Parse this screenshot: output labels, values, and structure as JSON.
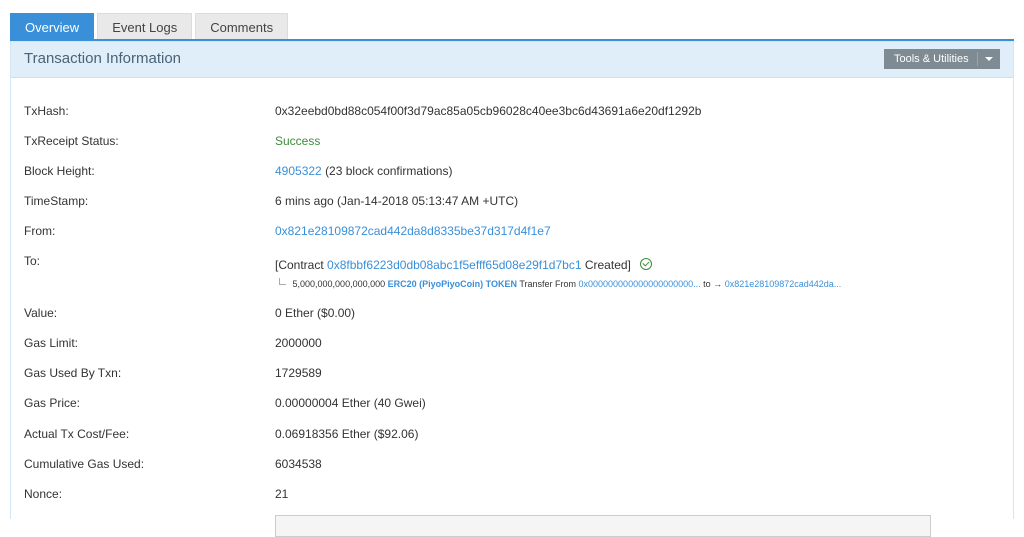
{
  "tabs": [
    "Overview",
    "Event Logs",
    "Comments"
  ],
  "panel": {
    "title": "Transaction Information",
    "tools_label": "Tools & Utilities"
  },
  "fields": {
    "txhash": {
      "label": "TxHash:",
      "value": "0x32eebd0bd88c054f00f3d79ac85a05cb96028c40ee3bc6d43691a6e20df1292b"
    },
    "status": {
      "label": "TxReceipt Status:",
      "value": "Success"
    },
    "block": {
      "label": "Block Height:",
      "link": "4905322",
      "suffix": "(23 block confirmations)"
    },
    "timestamp": {
      "label": "TimeStamp:",
      "value": "6 mins ago (Jan-14-2018 05:13:47 AM +UTC)"
    },
    "from": {
      "label": "From:",
      "value": "0x821e28109872cad442da8d8335be37d317d4f1e7"
    },
    "to": {
      "label": "To:",
      "prefix": "[Contract",
      "contract": "0x8fbbf6223d0db08abc1f5efff65d08e29f1d7bc1",
      "suffix": "Created]",
      "transfer": {
        "amount": "5,000,000,000,000,000",
        "token": "ERC20 (PiyoPiyoCoin) TOKEN",
        "text_from": "Transfer From",
        "from_addr": "0x000000000000000000000...",
        "text_to": "to →",
        "to_addr": "0x821e28109872cad442da..."
      }
    },
    "value": {
      "label": "Value:",
      "value": "0 Ether ($0.00)"
    },
    "gas_limit": {
      "label": "Gas Limit:",
      "value": "2000000"
    },
    "gas_used": {
      "label": "Gas Used By Txn:",
      "value": "1729589"
    },
    "gas_price": {
      "label": "Gas Price:",
      "value": "0.00000004 Ether (40 Gwei)"
    },
    "fee": {
      "label": "Actual Tx Cost/Fee:",
      "value": "0.06918356 Ether ($92.06)"
    },
    "cumulative": {
      "label": "Cumulative Gas Used:",
      "value": "6034538"
    },
    "nonce": {
      "label": "Nonce:",
      "value": "21"
    }
  }
}
